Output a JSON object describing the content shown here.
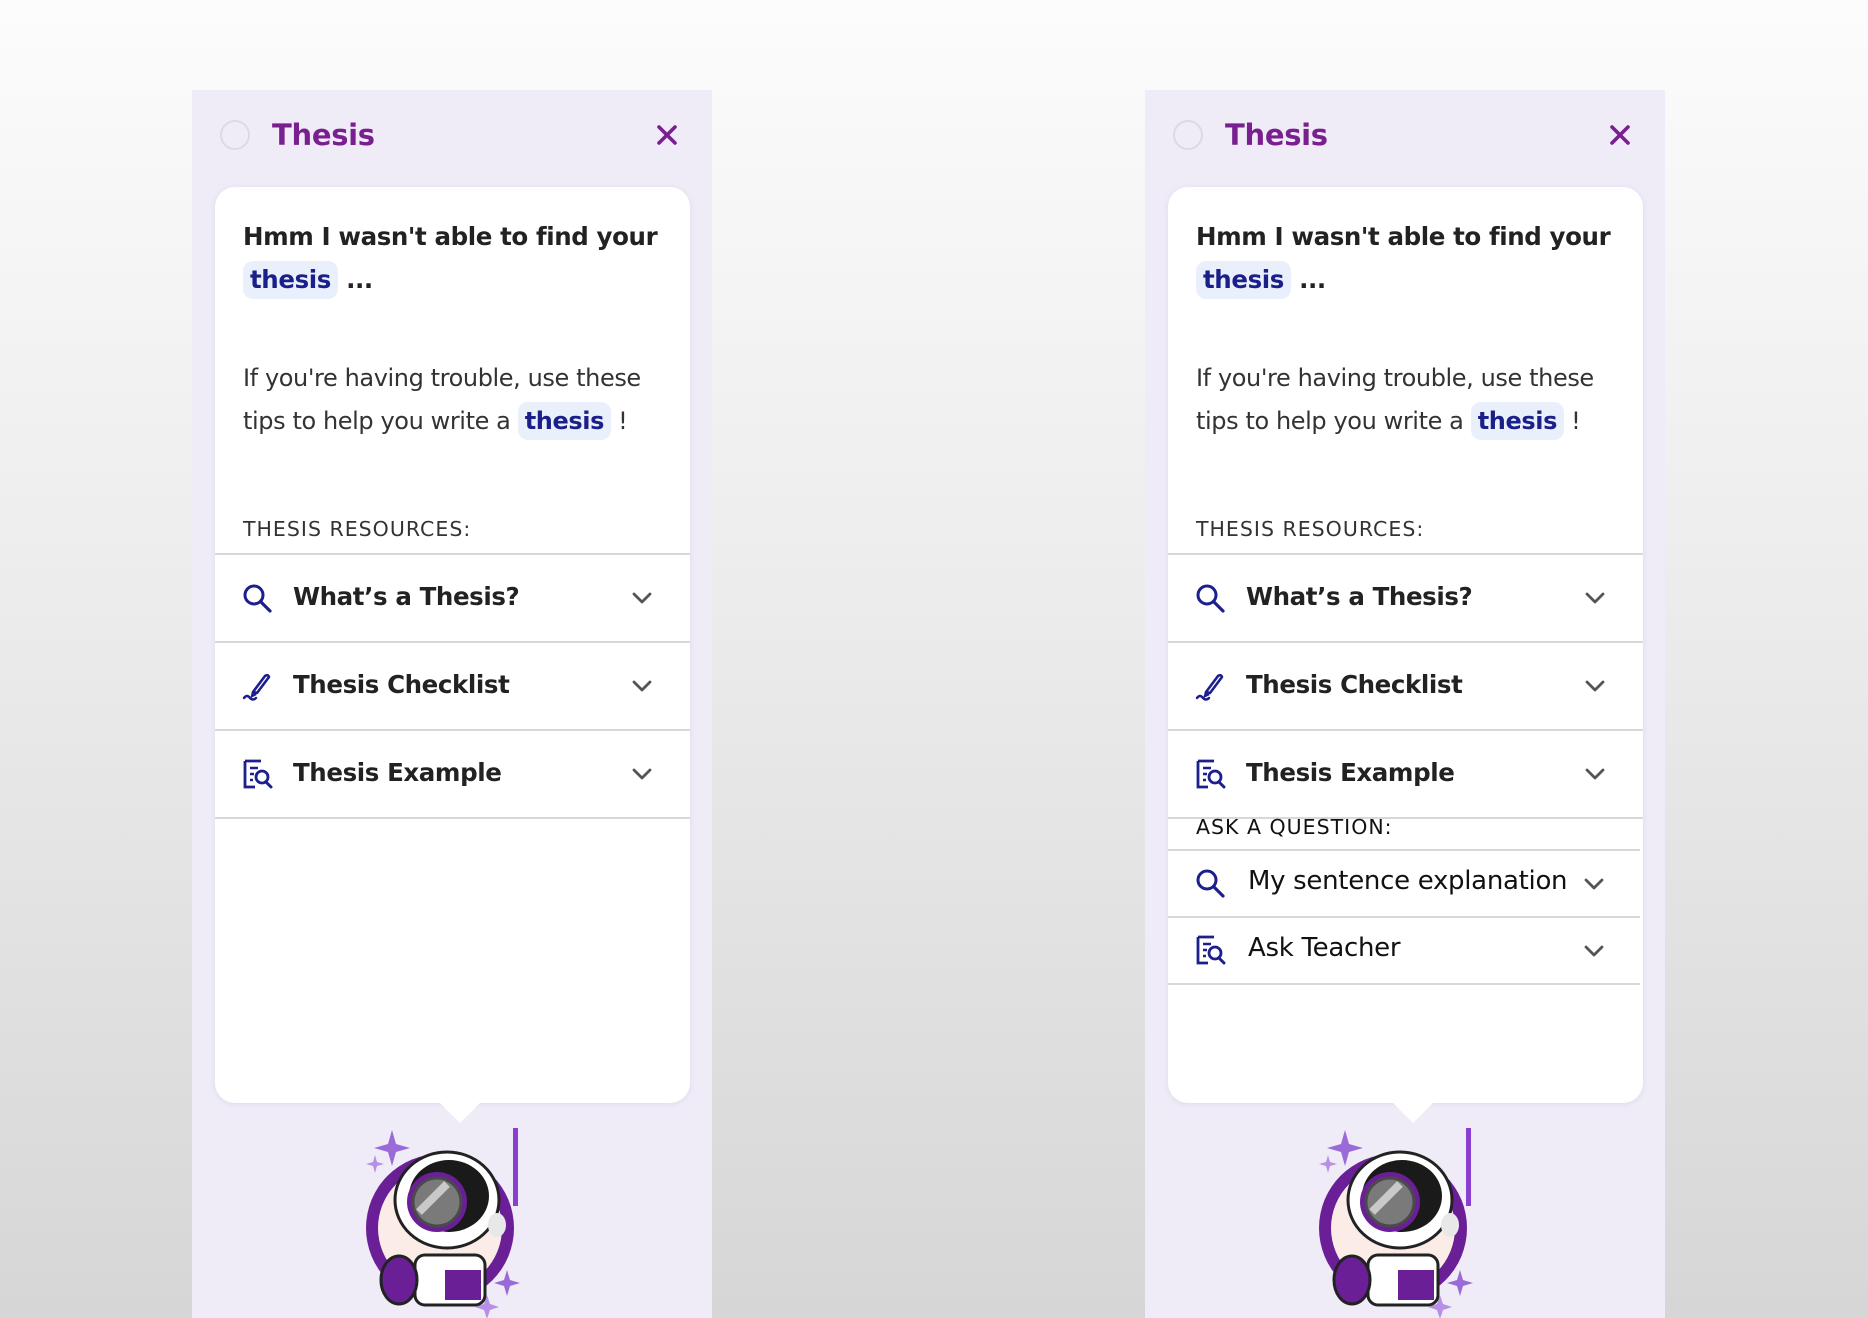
{
  "panels": [
    {
      "title": "Thesis",
      "message": {
        "line1_prefix": "Hmm I wasn't able to find your",
        "chip": "thesis",
        "line1_suffix": " ...",
        "tips_prefix": "If you're having trouble, use these tips to help you write a ",
        "tips_chip": "thesis",
        "tips_suffix": " !"
      },
      "resources_heading": "THESIS RESOURCES:",
      "resources": [
        {
          "label": "What’s a Thesis?",
          "icon": "search-icon"
        },
        {
          "label": "Thesis Checklist",
          "icon": "pencil-icon"
        },
        {
          "label": "Thesis Example",
          "icon": "document-search-icon"
        }
      ]
    },
    {
      "title": "Thesis",
      "message": {
        "line1_prefix": "Hmm I wasn't able to find your",
        "chip": "thesis",
        "line1_suffix": " ...",
        "tips_prefix": "If you're having trouble, use these tips to help you write a ",
        "tips_chip": "thesis",
        "tips_suffix": " !"
      },
      "resources_heading": "THESIS RESOURCES:",
      "resources": [
        {
          "label": "What’s a Thesis?",
          "icon": "search-icon"
        },
        {
          "label": "Thesis Checklist",
          "icon": "pencil-icon"
        },
        {
          "label": "Thesis Example",
          "icon": "document-search-icon"
        }
      ],
      "questions_heading": "ASK A QUESTION:",
      "questions": [
        {
          "label": "My sentence explanation",
          "icon": "search-icon"
        },
        {
          "label": "Ask Teacher",
          "icon": "document-search-icon"
        }
      ]
    }
  ],
  "colors": {
    "panel_bg": "#efecf8",
    "title_purple": "#7a1f8f",
    "icon_navy": "#1c1f8c",
    "chip_bg": "#eaf0fb"
  }
}
